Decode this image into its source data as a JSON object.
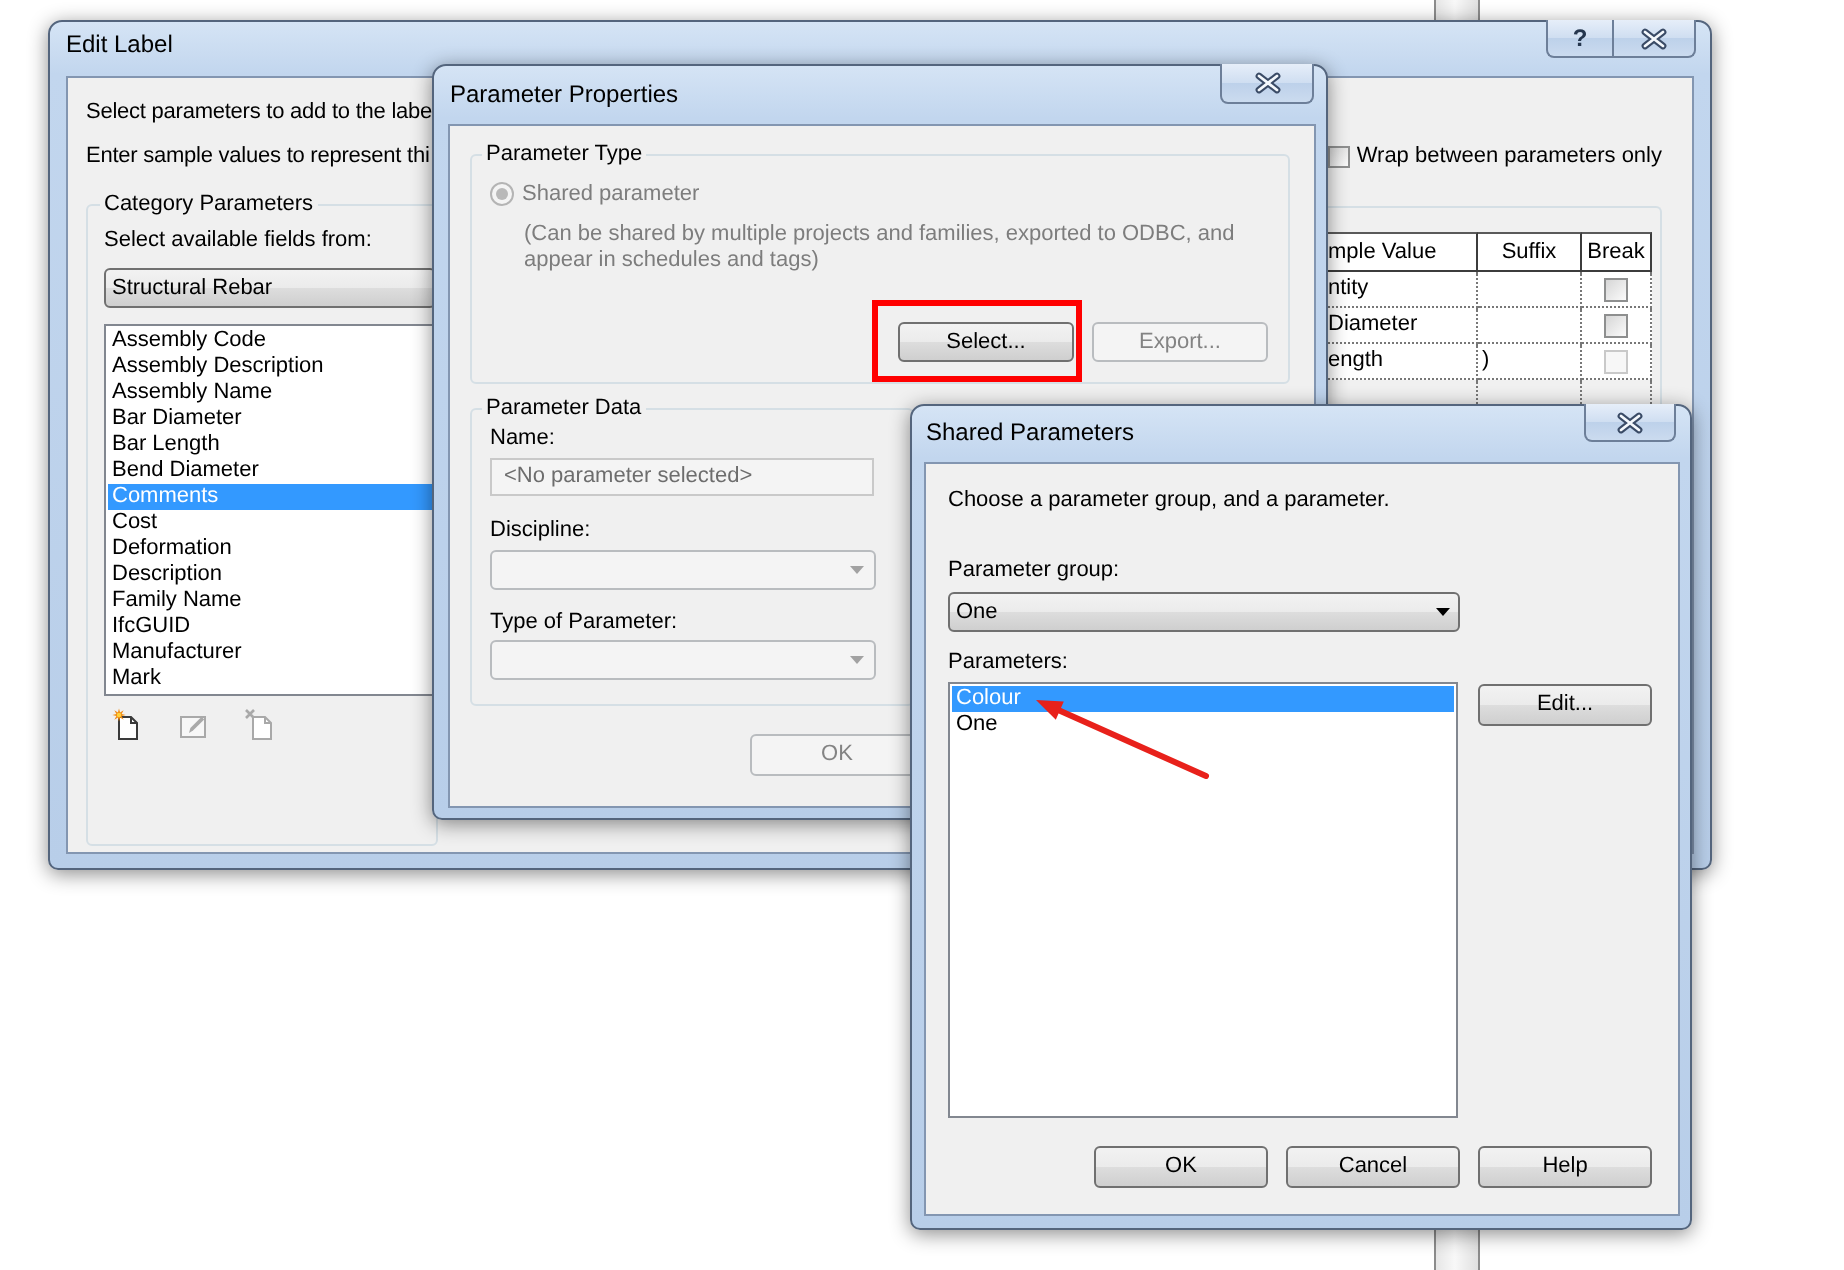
{
  "edit_label": {
    "title": "Edit Label",
    "help_glyph": "?",
    "instructions": [
      "Select parameters to add to the labe",
      "Enter sample values to represent thi"
    ],
    "wrap_option": {
      "label": "Wrap between parameters only",
      "checked": false
    },
    "category_parameters": {
      "title": "Category Parameters",
      "source_label": "Select available fields from:",
      "source_value": "Structural Rebar",
      "fields": [
        {
          "label": "Assembly Code",
          "selected": false
        },
        {
          "label": "Assembly Description",
          "selected": false
        },
        {
          "label": "Assembly Name",
          "selected": false
        },
        {
          "label": "Bar Diameter",
          "selected": false
        },
        {
          "label": "Bar Length",
          "selected": false
        },
        {
          "label": "Bend Diameter",
          "selected": false
        },
        {
          "label": "Comments",
          "selected": true
        },
        {
          "label": "Cost",
          "selected": false
        },
        {
          "label": "Deformation",
          "selected": false
        },
        {
          "label": "Description",
          "selected": false
        },
        {
          "label": "Family Name",
          "selected": false
        },
        {
          "label": "IfcGUID",
          "selected": false
        },
        {
          "label": "Manufacturer",
          "selected": false
        },
        {
          "label": "Mark",
          "selected": false
        }
      ],
      "tools": [
        {
          "kind": "add",
          "disabled": false
        },
        {
          "kind": "edit",
          "disabled": true
        },
        {
          "kind": "delete",
          "disabled": true
        }
      ]
    },
    "label_table": {
      "columns": [
        "mple Value",
        "Suffix",
        "Break"
      ],
      "rows": [
        {
          "sample_value": "ntity",
          "break_checked": false,
          "break_disabled": false
        },
        {
          "sample_value": "Diameter",
          "break_checked": false,
          "break_disabled": false
        },
        {
          "sample_value": "ength",
          "suffix": ")",
          "break_checked": false,
          "break_disabled": true
        }
      ]
    }
  },
  "parameter_properties": {
    "title": "Parameter Properties",
    "type_group": {
      "title": "Parameter Type",
      "option": {
        "label": "Shared parameter",
        "selected": true,
        "disabled": true
      },
      "description": "(Can be shared by multiple projects and families, exported to ODBC, and appear in schedules and tags)",
      "select_button": {
        "label": "Select...",
        "disabled": false,
        "highlighted": true
      },
      "export_button": {
        "label": "Export...",
        "disabled": true,
        "highlighted": false
      }
    },
    "data_group": {
      "title": "Parameter Data",
      "name_field": {
        "label": "Name:",
        "value": "<No parameter selected>",
        "disabled": true
      },
      "discipline": {
        "label": "Discipline:",
        "disabled": true
      },
      "parameter_type": {
        "label": "Type of Parameter:",
        "disabled": true
      }
    },
    "ok_button": {
      "label": "OK",
      "disabled": true
    }
  },
  "shared_parameters": {
    "title": "Shared Parameters",
    "prompt": "Choose a parameter group, and a parameter.",
    "group_label": "Parameter group:",
    "group_value": "One",
    "parameters_label": "Parameters:",
    "parameters": [
      {
        "label": "Colour",
        "selected": true,
        "annotated": true
      },
      {
        "label": "One",
        "selected": false,
        "annotated": false
      }
    ],
    "edit_button": "Edit...",
    "ok_button": "OK",
    "cancel_button": "Cancel",
    "help_button": "Help"
  }
}
